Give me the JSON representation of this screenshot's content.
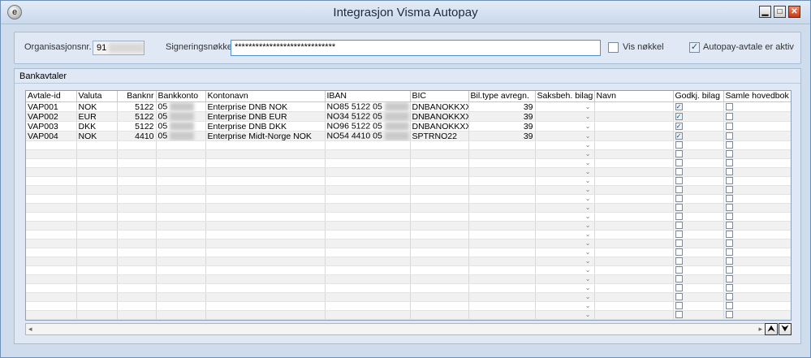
{
  "window": {
    "title": "Integrasjon Visma Autopay"
  },
  "title_buttons": {
    "min": "▁",
    "max": "□",
    "close": "✕"
  },
  "icons": {
    "app": "app-logo-icon"
  },
  "top": {
    "org_label": "Organisasjonsnr.",
    "org_value": "91",
    "sign_label": "Signeringsnøkkel",
    "sign_value": "*****************************",
    "vis_label": "Vis nøkkel",
    "vis_checked": false,
    "aktiv_label": "Autopay-avtale er aktiv",
    "aktiv_checked": true
  },
  "section": {
    "title": "Bankavtaler"
  },
  "table": {
    "headers": [
      "Avtale-id",
      "Valuta",
      "Banknr",
      "Bankkonto",
      "Kontonavn",
      "IBAN",
      "BIC",
      "Bil.type avregn.",
      "Saksbeh. bilag",
      "Navn",
      "Godkj. bilag",
      "Samle hovedbok"
    ],
    "rows": [
      {
        "avtale": "VAP001",
        "valuta": "NOK",
        "banknr": "5122",
        "konto": "05",
        "kontonavn": "Enterprise DNB NOK",
        "iban": "NO85 5122 05",
        "bic": "DNBANOKKXXX",
        "biltype": "39",
        "godkj": true,
        "samle": false
      },
      {
        "avtale": "VAP002",
        "valuta": "EUR",
        "banknr": "5122",
        "konto": "05",
        "kontonavn": "Enterprise DNB EUR",
        "iban": "NO34 5122 05",
        "bic": "DNBANOKKXXX",
        "biltype": "39",
        "godkj": true,
        "samle": false
      },
      {
        "avtale": "VAP003",
        "valuta": "DKK",
        "banknr": "5122",
        "konto": "05",
        "kontonavn": "Enterprise DNB DKK",
        "iban": "NO96 5122 05",
        "bic": "DNBANOKKXXX",
        "biltype": "39",
        "godkj": true,
        "samle": false
      },
      {
        "avtale": "VAP004",
        "valuta": "NOK",
        "banknr": "4410",
        "konto": "05",
        "kontonavn": "Enterprise Midt-Norge NOK",
        "iban": "NO54 4410 05",
        "bic": "SPTRNO22",
        "biltype": "39",
        "godkj": true,
        "samle": false
      }
    ],
    "empty_rows": 20
  },
  "scroll": {
    "left": "◂",
    "right": "▸",
    "up": "⮝",
    "down": "⮟"
  }
}
